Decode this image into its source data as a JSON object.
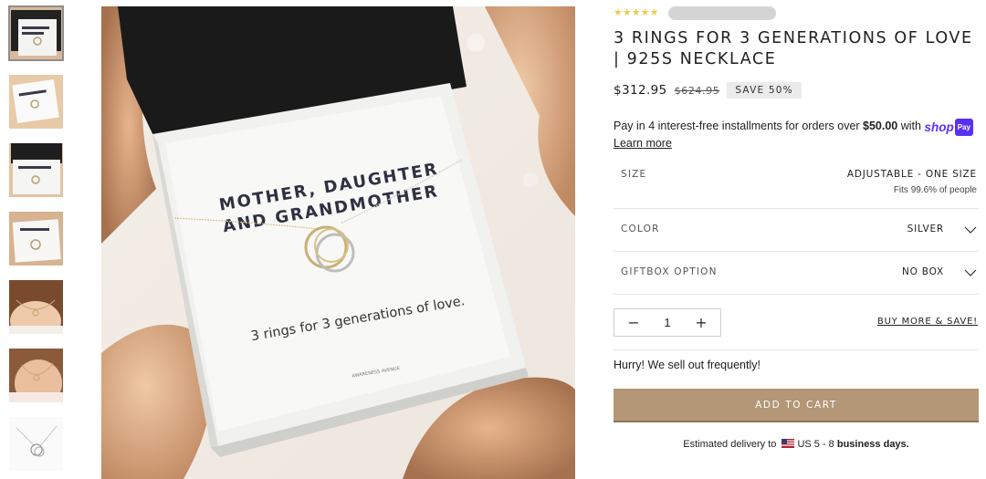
{
  "thumbnails": [
    {
      "alt": "box-front"
    },
    {
      "alt": "box-angle"
    },
    {
      "alt": "box-open"
    },
    {
      "alt": "box-closeup"
    },
    {
      "alt": "model-neck"
    },
    {
      "alt": "model-close"
    },
    {
      "alt": "necklace-only"
    }
  ],
  "main_image": {
    "card_heading_line1": "MOTHER, DAUGHTER",
    "card_heading_line2": "AND GRANDMOTHER",
    "card_tagline": "3 rings for 3 generations of love.",
    "card_brand": "AWARENESS AVENUE"
  },
  "product": {
    "rating_stars": 5,
    "title": "3 RINGS FOR 3 GENERATIONS OF LOVE | 925S NECKLACE",
    "price": "$312.95",
    "compare_price": "$624.95",
    "save_badge": "SAVE 50%",
    "installments_prefix": "Pay in 4 interest-free installments for orders over ",
    "installments_amount": "$50.00",
    "installments_suffix": " with ",
    "shop_pay_word": "shop",
    "shop_pay_box": "Pay",
    "learn_more": "Learn more"
  },
  "options": {
    "size_label": "SIZE",
    "size_value": "ADJUSTABLE - ONE SIZE",
    "size_sub": "Fits 99.6% of people",
    "color_label": "COLOR",
    "color_value": "SILVER",
    "giftbox_label": "GIFTBOX OPTION",
    "giftbox_value": "NO BOX"
  },
  "purchase": {
    "qty_minus": "−",
    "qty_value": "1",
    "qty_plus": "+",
    "buy_more": "BUY MORE & SAVE!",
    "hurry": "Hurry! We sell out frequently!",
    "add_to_cart": "ADD TO CART",
    "delivery_prefix": "Estimated delivery to",
    "delivery_country": "US",
    "delivery_range": "5 - 8",
    "delivery_suffix": "business days."
  },
  "colors": {
    "star": "#f2c94c",
    "cart_button": "#b39776",
    "shop_pay": "#5a31f4"
  }
}
